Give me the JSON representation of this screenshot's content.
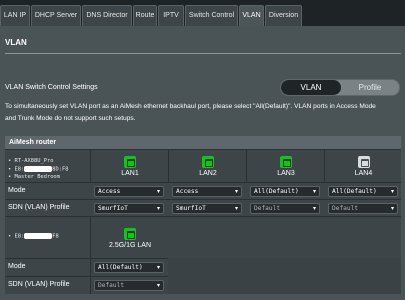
{
  "tabs": [
    {
      "label": "LAN IP"
    },
    {
      "label": "DHCP Server"
    },
    {
      "label": "DNS Director"
    },
    {
      "label": "Route"
    },
    {
      "label": "IPTV"
    },
    {
      "label": "Switch Control"
    },
    {
      "label": "VLAN",
      "active": true
    },
    {
      "label": "Diversion"
    }
  ],
  "page": {
    "title": "VLAN",
    "control_label": "VLAN Switch Control Settings",
    "segment": {
      "active": "VLAN",
      "inactive": "Profile"
    },
    "info_line1": "To simultaneously set VLAN port as an AiMesh ethernet backhaul port, please select \"All(Default)\". VLAN ports in Access Mode",
    "info_line2": "and Trunk Mode do not support such setups."
  },
  "table": {
    "title": "AiMesh router",
    "router": {
      "line1": "• RT-AX88U_Pro",
      "line2_prefix": "• E8:",
      "line2_suffix": "8D:F8",
      "line3": "• Master Bedroom"
    },
    "ports": [
      {
        "label": "LAN1",
        "icon": "green"
      },
      {
        "label": "LAN2",
        "icon": "green"
      },
      {
        "label": "LAN3",
        "icon": "green"
      },
      {
        "label": "LAN4",
        "icon": "gray"
      }
    ],
    "mode_label": "Mode",
    "profile_label": "SDN (VLAN) Profile",
    "modes": [
      "Access",
      "Access",
      "All(Default)",
      "All(Default)"
    ],
    "profiles": [
      "SmurfIoT",
      "SmurfIoT",
      "Default",
      "Default"
    ],
    "node": {
      "line_prefix": "• E8:",
      "line_suffix": "F8",
      "port_label": "2.5G/1G LAN",
      "mode": "All(Default)",
      "profile": "Default"
    }
  },
  "colors": {
    "port_active": "#16c01d",
    "port_inactive": "#d8dcde",
    "panel": "#4a5457"
  }
}
